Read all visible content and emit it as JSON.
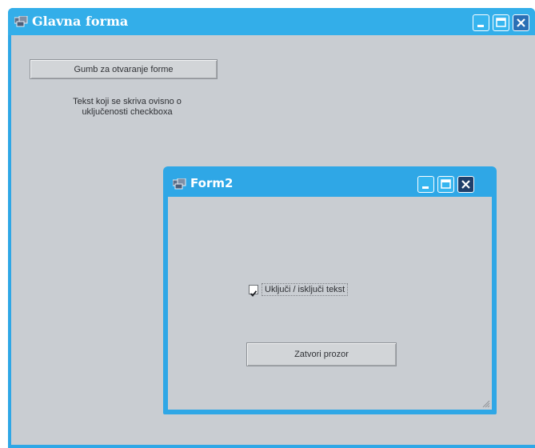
{
  "main_window": {
    "title": "Glavna forma",
    "icons": {
      "app": "app-icon",
      "minimize": "minimize-icon",
      "maximize": "maximize-icon",
      "close": "close-icon"
    },
    "open_form_button_label": "Gumb za otvaranje forme",
    "toggle_label_line1": "Tekst koji se skriva ovisno o",
    "toggle_label_line2": "uključenosti checkboxa"
  },
  "form2": {
    "title": "Form2",
    "checkbox_label": "Uključi / isključi tekst",
    "checkbox_checked": true,
    "close_button_label": "Zatvori prozor"
  },
  "colors": {
    "titlebar": "#33aee9",
    "client": "#c9cdd2"
  }
}
